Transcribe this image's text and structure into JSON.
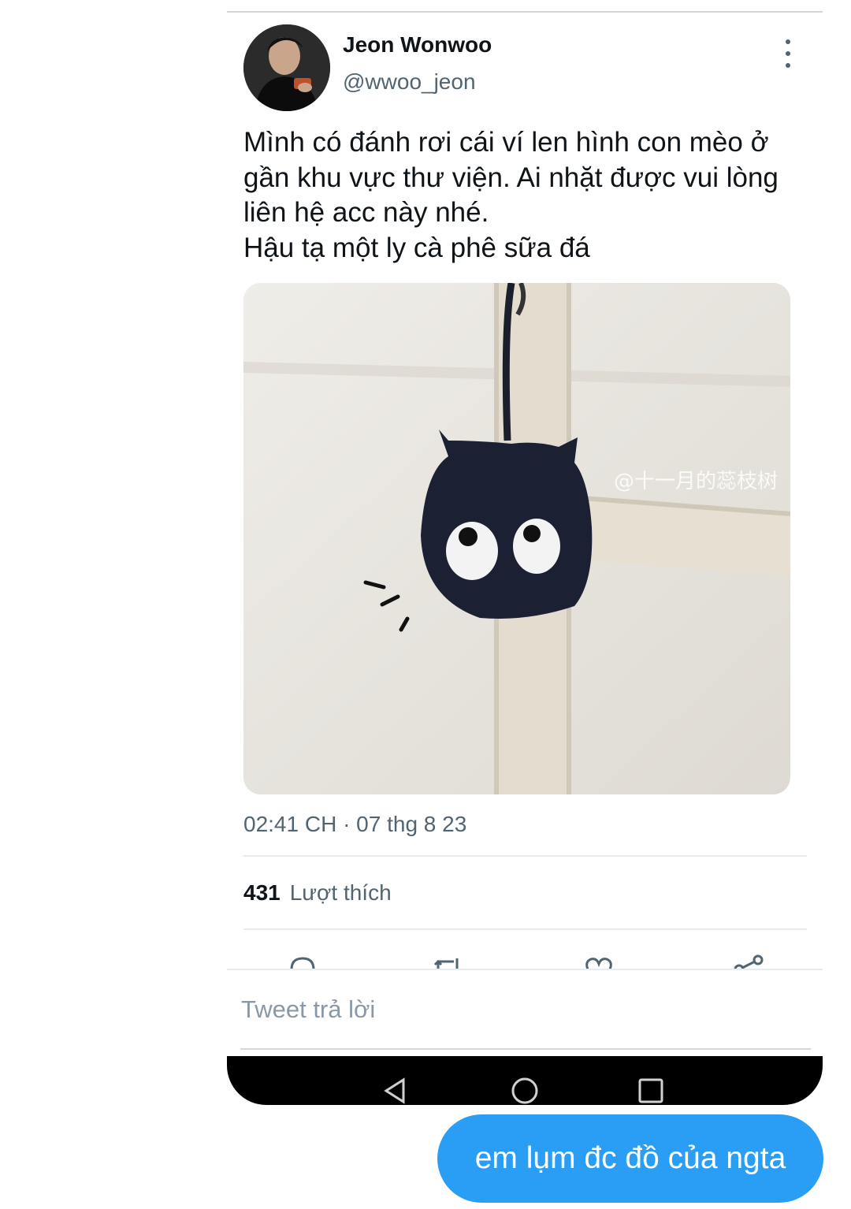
{
  "tweet": {
    "display_name": "Jeon Wonwoo",
    "handle": "@wwoo_jeon",
    "text": "Mình có đánh rơi cái ví len hình con mèo ở\ngần khu vực thư viện. Ai nhặt được vui lòng\nliên hệ acc này nhé.\nHậu tạ một ly cà phê sữa đá",
    "timestamp": "02:41 CH · 07 thg 8 23",
    "likes_count": "431",
    "likes_label": "Lượt thích",
    "image_watermark": "@十一月的蕊枝树"
  },
  "reply": {
    "placeholder": "Tweet trả lời"
  },
  "message": {
    "text": "em lụm đc đồ của ngta"
  },
  "icons": [
    "more-vertical-icon",
    "reply-icon",
    "retweet-icon",
    "like-icon",
    "share-icon",
    "back-icon",
    "home-icon",
    "recents-icon"
  ],
  "colors": {
    "accent": "#2a9df4",
    "muted_text": "#536471",
    "navbar": "#000000"
  }
}
